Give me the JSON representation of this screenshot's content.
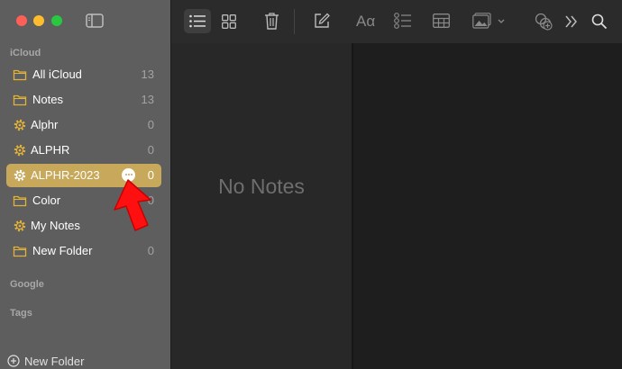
{
  "window": {
    "traffic_lights": [
      "close",
      "minimize",
      "zoom"
    ]
  },
  "sidebar": {
    "sections": {
      "icloud": "iCloud",
      "google": "Google",
      "tags": "Tags"
    },
    "folders": [
      {
        "name": "All iCloud",
        "count": "13",
        "icon": "folder-icon"
      },
      {
        "name": "Notes",
        "count": "13",
        "icon": "folder-icon"
      },
      {
        "name": "Alphr",
        "count": "0",
        "icon": "gear-icon"
      },
      {
        "name": "ALPHR",
        "count": "0",
        "icon": "gear-icon"
      },
      {
        "name": "ALPHR-2023",
        "count": "0",
        "icon": "gear-icon",
        "selected": true
      },
      {
        "name": "Color",
        "count": "0",
        "icon": "folder-icon"
      },
      {
        "name": "My Notes",
        "count": "",
        "icon": "gear-icon"
      },
      {
        "name": "New Folder",
        "count": "0",
        "icon": "folder-icon"
      }
    ],
    "new_folder_label": "New Folder"
  },
  "toolbar": {
    "icons": [
      "list-view-icon",
      "gallery-view-icon",
      "trash-icon",
      "compose-icon",
      "format-text-icon",
      "checklist-icon",
      "table-icon",
      "media-icon",
      "collaborate-icon",
      "more-icon",
      "search-icon"
    ],
    "format_label": "Aα"
  },
  "note_list": {
    "empty_label": "No Notes"
  },
  "colors": {
    "selection": "#c8a85a",
    "accent": "#e2b23a",
    "annotation_arrow": "#ff0000"
  }
}
